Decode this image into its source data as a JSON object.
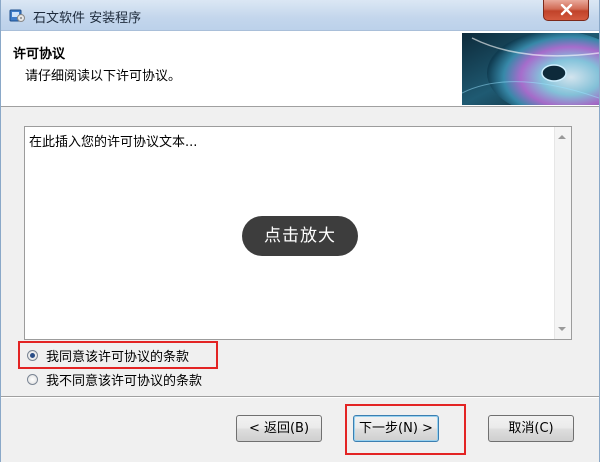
{
  "window": {
    "title": "石文软件 安装程序",
    "icons": {
      "app": "installer-icon",
      "close": "close-icon"
    },
    "colors": {
      "close": "#c7472e",
      "highlight": "#e32424"
    }
  },
  "header": {
    "title": "许可协议",
    "subtitle": "请仔细阅读以下许可协议。",
    "image": "cd-disc-image"
  },
  "license": {
    "text": "在此插入您的许可协议文本..."
  },
  "overlay": {
    "zoom_label": "点击放大"
  },
  "options": {
    "agree": {
      "label": "我同意该许可协议的条款",
      "checked": true
    },
    "disagree": {
      "label": "我不同意该许可协议的条款",
      "checked": false
    }
  },
  "buttons": {
    "back": "< 返回(B)",
    "next": "下一步(N) >",
    "cancel": "取消(C)"
  }
}
